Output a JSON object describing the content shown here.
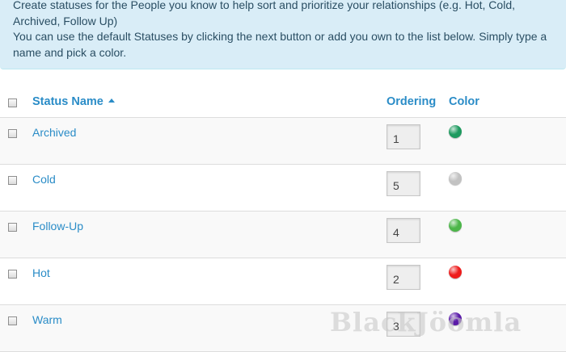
{
  "info": {
    "line1": "Create statuses for the People you know to help sort and prioritize your relationships (e.g. Hot, Cold,",
    "line2": "Archived, Follow Up)",
    "line3": "You can use the default Statuses by clicking the next button or add you own to the list below. Simply type a",
    "line4": "name and pick a color."
  },
  "table": {
    "headers": {
      "name": "Status Name",
      "ordering": "Ordering",
      "color": "Color"
    },
    "sort": "ascending",
    "rows": [
      {
        "name": "Archived",
        "ordering": "1",
        "color": "#1e9a5f"
      },
      {
        "name": "Cold",
        "ordering": "5",
        "color": "#c2c2c2"
      },
      {
        "name": "Follow-Up",
        "ordering": "4",
        "color": "#4cb649"
      },
      {
        "name": "Hot",
        "ordering": "2",
        "color": "#ee1c1c"
      },
      {
        "name": "Warm",
        "ordering": "3",
        "color": "#5a1aa8"
      }
    ]
  },
  "watermark": "BlackJöomla"
}
